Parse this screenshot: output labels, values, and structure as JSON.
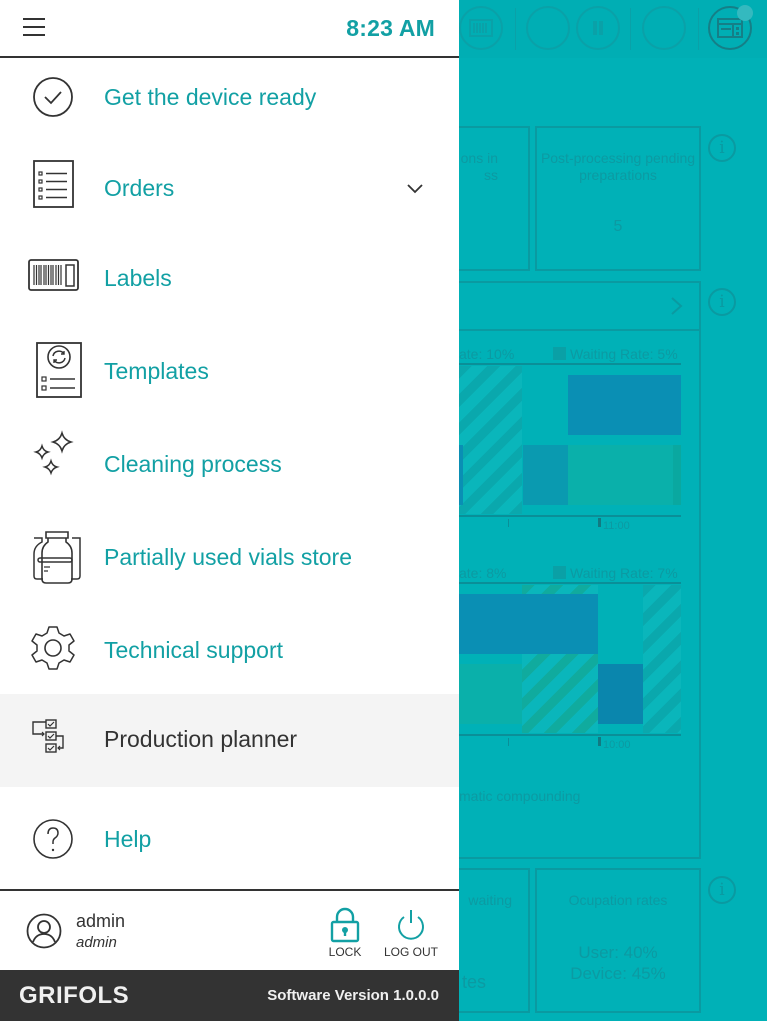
{
  "header": {
    "time": "8:23 AM"
  },
  "menu": {
    "items": [
      {
        "label": "Get the device ready",
        "icon": "check-circle-icon"
      },
      {
        "label": "Orders",
        "icon": "orders-list-icon",
        "expandable": true
      },
      {
        "label": "Labels",
        "icon": "barcode-label-icon"
      },
      {
        "label": "Templates",
        "icon": "template-sync-icon"
      },
      {
        "label": "Cleaning process",
        "icon": "sparkles-icon"
      },
      {
        "label": "Partially used vials store",
        "icon": "vials-icon"
      },
      {
        "label": "Technical support",
        "icon": "gear-icon"
      },
      {
        "label": "Production planner",
        "icon": "planner-icon",
        "active": true
      },
      {
        "label": "Help",
        "icon": "help-circle-icon"
      }
    ]
  },
  "user": {
    "name": "admin",
    "role": "admin",
    "lock_label": "LOCK",
    "logout_label": "LOG OUT"
  },
  "footer": {
    "brand": "GRIFOLS",
    "version": "Software Version 1.0.0.0"
  },
  "colors": {
    "accent": "#12a0a4",
    "overlay": "#00b1b7",
    "footer_bg": "#333333",
    "active_item_bg": "#f4f4f4"
  },
  "background": {
    "cards_top": [
      {
        "title": "ons in\nss",
        "value": ""
      },
      {
        "title": "Post-processing pending preparations",
        "value": "5"
      }
    ],
    "chart1": {
      "legend_left": "ate: 10%",
      "legend_right": "Waiting Rate: 5%",
      "tick_label": "11:00"
    },
    "chart2": {
      "legend_left": "ate: 8%",
      "legend_right": "Waiting Rate: 7%",
      "tick_label": "10:00"
    },
    "panel_caption": "matic compounding",
    "cards_bottom": [
      {
        "title": "waiting",
        "value": "tes"
      },
      {
        "title": "Ocupation rates",
        "line1": "User: 40%",
        "line2": "Device: 45%"
      }
    ]
  }
}
